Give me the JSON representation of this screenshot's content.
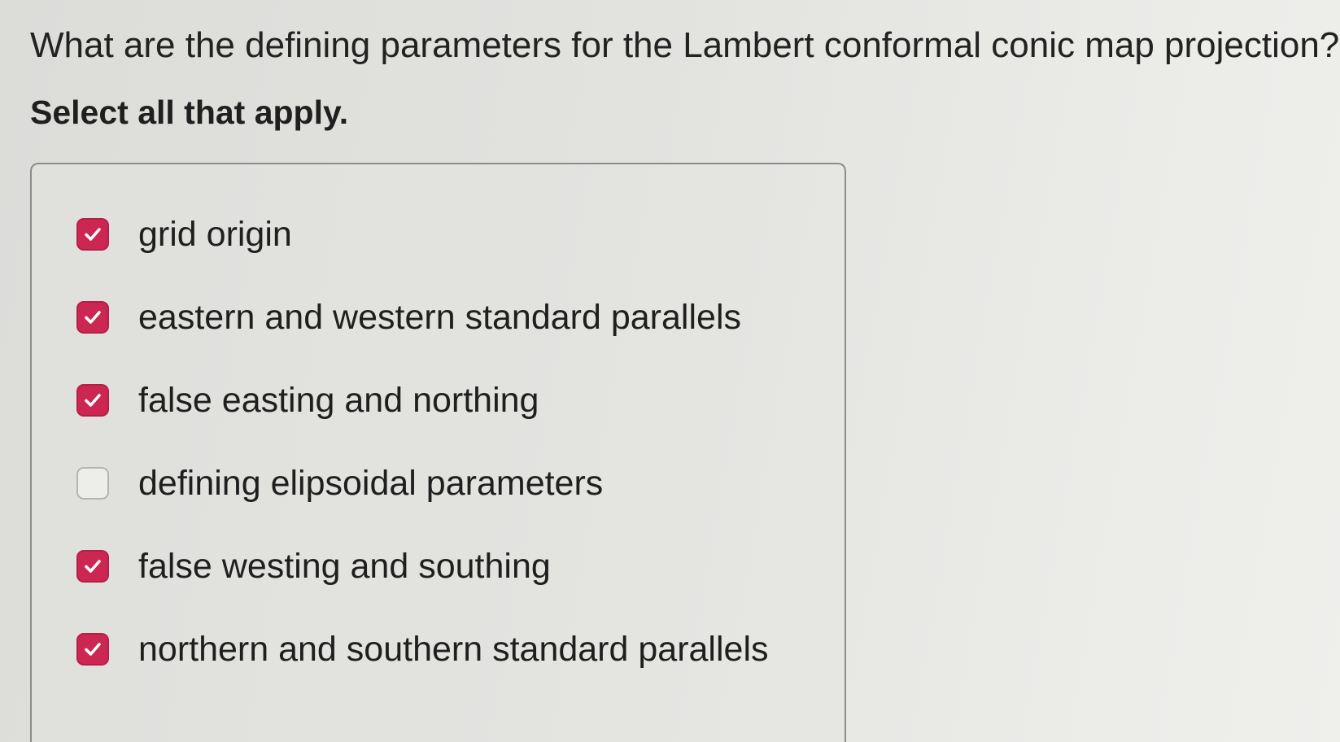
{
  "question": {
    "text": "What are the defining parameters for the Lambert conformal conic map projection?",
    "instruction": "Select all that apply."
  },
  "options": [
    {
      "label": "grid origin",
      "checked": true
    },
    {
      "label": "eastern and western standard parallels",
      "checked": true
    },
    {
      "label": "false easting and northing",
      "checked": true
    },
    {
      "label": "defining elipsoidal parameters",
      "checked": false
    },
    {
      "label": "false westing and southing",
      "checked": true
    },
    {
      "label": "northern and southern standard parallels",
      "checked": true
    }
  ],
  "colors": {
    "checked_fill": "#cc2752",
    "unchecked_fill": "#ededea",
    "text": "#1f1f1f"
  }
}
